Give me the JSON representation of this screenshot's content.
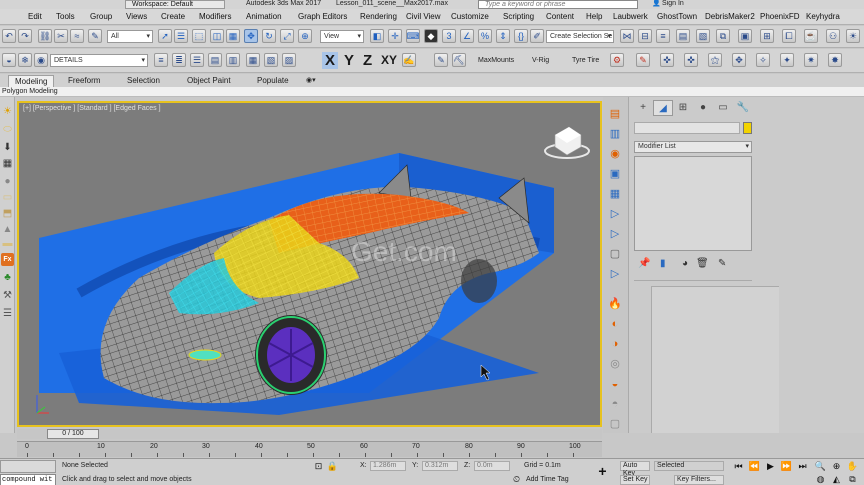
{
  "titlebar": {
    "workspace": "Workspace: Default",
    "app_title": "Autodesk 3ds Max 2017",
    "document": "Lesson_011_scene__Max2017.max",
    "search_placeholder": "Type a keyword or phrase",
    "sign_in": "Sign In"
  },
  "menu": {
    "items": [
      "Edit",
      "Tools",
      "Group",
      "Views",
      "Create",
      "Modifiers",
      "Animation",
      "Graph Editors",
      "Rendering",
      "Civil View",
      "Customize",
      "Scripting",
      "Content",
      "Help",
      "Laubwerk",
      "GhostTown",
      "DebrisMaker2",
      "PhoenixFD",
      "Keyhydra"
    ]
  },
  "toolbar1": {
    "filter": "All",
    "view": "View",
    "selection_set": "Create Selection Se"
  },
  "toolbar2": {
    "layer": "DETAILS",
    "axis_x": "X",
    "axis_y": "Y",
    "axis_z": "Z",
    "axis_xy": "XY",
    "maxmounts": "MaxMounts",
    "vrig": "V-Rig",
    "tyre_tire": "Tyre Tire"
  },
  "ribbon": {
    "tabs": [
      "Modeling",
      "Freeform",
      "Selection",
      "Object Paint",
      "Populate"
    ],
    "active_tab": "Modeling",
    "subpanel": "Polygon Modeling"
  },
  "viewport": {
    "label": "[+] [Perspective ] [Standard ] [Edged Faces ]",
    "watermark": "Get.com",
    "colors": {
      "background": "#7c7c7c",
      "border_active": "#e7c21e",
      "backdrop": "#1f6fe6",
      "mesh": "#9a9a9a",
      "roof_orange": "#e8601a",
      "roof_yellow": "#e9d21a",
      "glass_cyan": "#28c8d8",
      "wheel": "#5b2fbf"
    }
  },
  "command_panel": {
    "modifier_list": "Modifier List",
    "color_swatch": "#f2d300"
  },
  "timeline": {
    "frame_display": "0 / 100",
    "ticks": [
      "0",
      "10",
      "20",
      "30",
      "40",
      "50",
      "60",
      "70",
      "80",
      "90",
      "100"
    ]
  },
  "status": {
    "maxscript": "compound wit",
    "selection": "None Selected",
    "prompt": "Click and drag to select and move objects",
    "x_label": "X:",
    "x_value": "1.286m",
    "y_label": "Y:",
    "y_value": "0.312m",
    "z_label": "Z:",
    "z_value": "0.0m",
    "grid": "Grid = 0.1m",
    "add_time_tag": "Add Time Tag",
    "auto_key": "Auto Key",
    "selected": "Selected",
    "set_key": "Set Key",
    "key_filters": "Key Filters..."
  }
}
